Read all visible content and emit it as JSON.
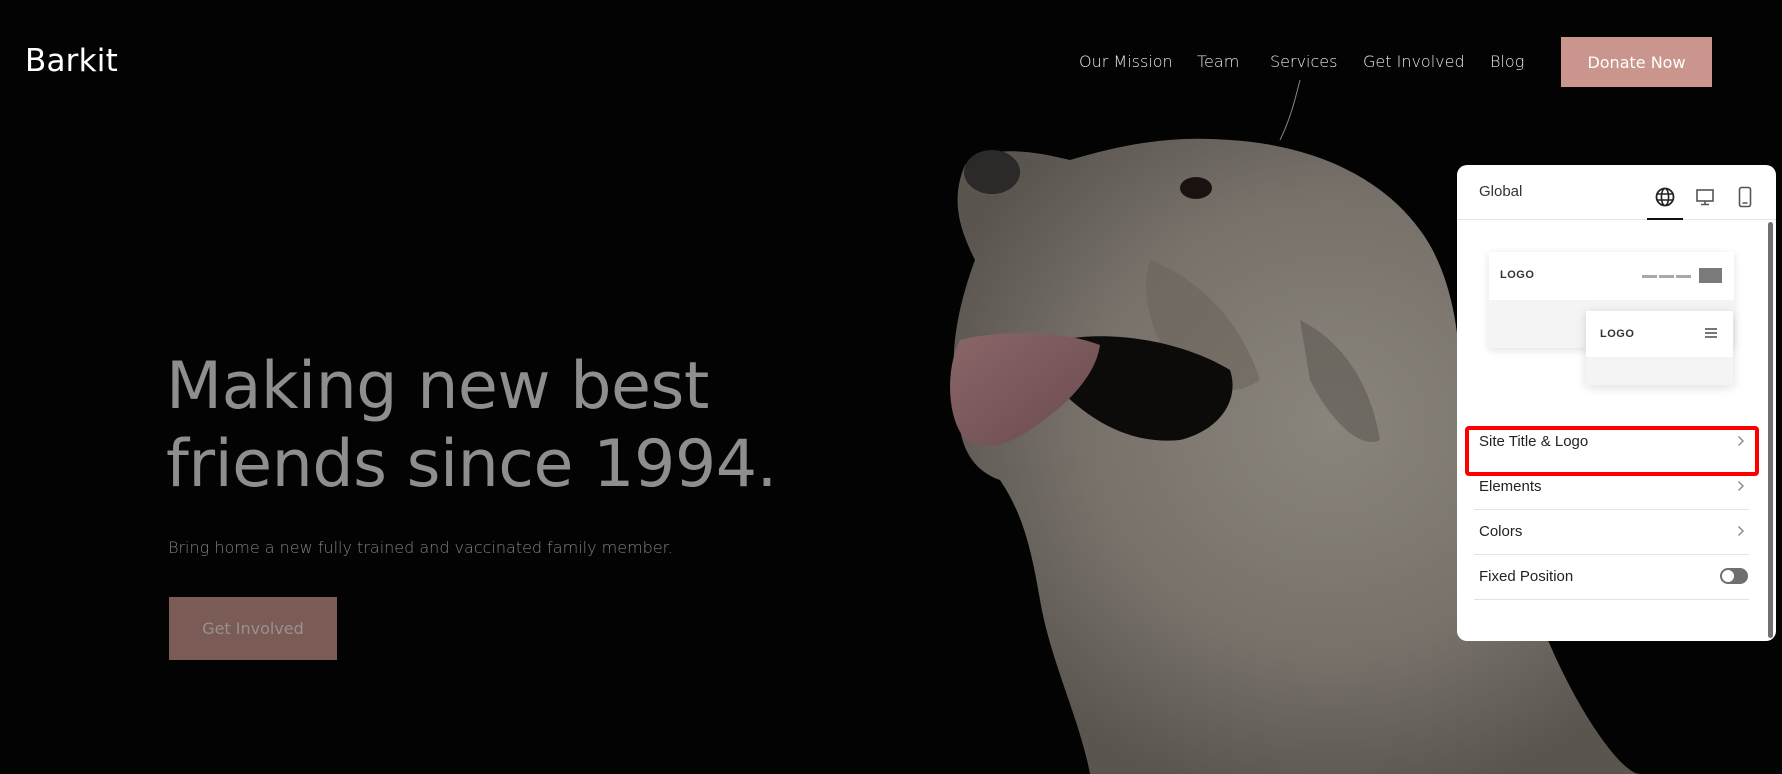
{
  "site": {
    "title": "Barkit"
  },
  "nav": {
    "items": [
      {
        "label": "Our Mission"
      },
      {
        "label": "Team"
      },
      {
        "label": "Services"
      },
      {
        "label": "Get Involved"
      },
      {
        "label": "Blog"
      }
    ],
    "donate_label": "Donate Now"
  },
  "hero": {
    "heading_line1": "Making new best",
    "heading_line2": "friends since 1994.",
    "subheading": "Bring home a new fully trained and vaccinated family member.",
    "cta_label": "Get Involved",
    "image": "golden-retriever-photo"
  },
  "panel": {
    "title": "Global",
    "device_tabs": [
      {
        "icon": "globe-icon",
        "active": true
      },
      {
        "icon": "desktop-icon",
        "active": false
      },
      {
        "icon": "mobile-icon",
        "active": false
      }
    ],
    "preview": {
      "desktop_logo": "LOGO",
      "mobile_logo": "LOGO"
    },
    "menu": [
      {
        "label": "Site Title & Logo",
        "type": "link",
        "highlighted": true
      },
      {
        "label": "Elements",
        "type": "link"
      },
      {
        "label": "Colors",
        "type": "link"
      },
      {
        "label": "Fixed Position",
        "type": "toggle",
        "value": false
      }
    ]
  },
  "colors": {
    "accent": "#c9958d",
    "cta_dimmed": "#7b5b56",
    "highlight": "#ff0000",
    "background": "#030303"
  }
}
